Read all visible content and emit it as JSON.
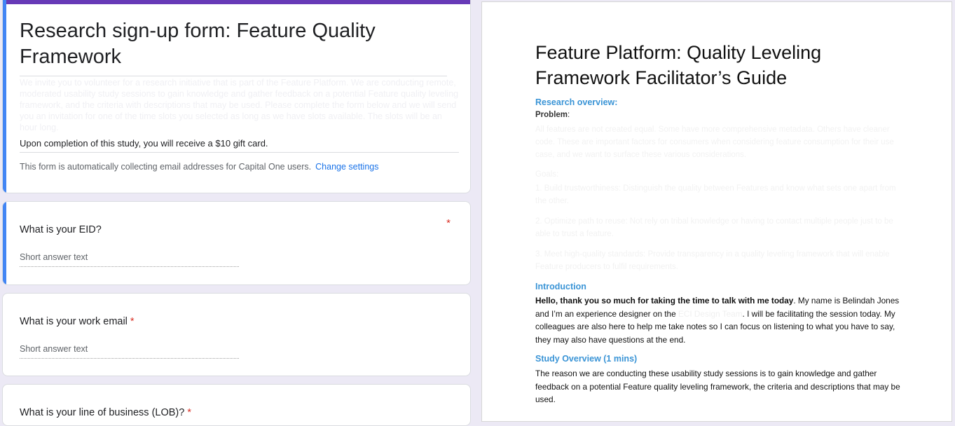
{
  "form": {
    "title": "Research sign-up form: Feature Quality Framework",
    "description": "We invite you to volunteer for a research initiative that is part of the Feature Platform. We are conducting remote, moderated usability study sessions to gain knowledge and gather feedback on a potential Feature quality leveling framework, and the criteria with descriptions that may be used. Please complete the form below and we will send you an invitation for one of the time slots you selected as long as we have slots available. The slots will be an hour long.",
    "note": "Upon completion of this study, you will receive a $10 gift card.",
    "collect_text": "This form is automatically collecting email addresses for Capital One users.",
    "collect_link": "Change settings",
    "questions": [
      {
        "title": "What is your EID?",
        "required_mark": "*",
        "placeholder": "Short answer text"
      },
      {
        "title": "What is your work email",
        "required_mark": "*",
        "placeholder": "Short answer text"
      },
      {
        "title": "What is your line of business (LOB)?",
        "required_mark": "*"
      }
    ],
    "colors": {
      "accent": "#673ab7",
      "focus_bar": "#4285f4",
      "required": "#d93025",
      "link": "#1a73e8"
    }
  },
  "doc": {
    "title": "Feature Platform: Quality Leveling Framework Facilitator’s Guide",
    "research_overview": "Research overview:",
    "problem_label": "Problem",
    "problem_colon": ":",
    "problem_text": "All features are not created equal. Some have more comprehensive metadata. Others have cleaner code. These are important factors for consumers when considering feature consumption for their use case, and we want to surface these various considerations.",
    "goals_label": "Goals:",
    "goals": [
      "1. Build trustworthiness: Distinguish the quality between Features and know what sets one apart from the other.",
      "2. Optimize path to reuse: Not rely on tribal knowledge or having to contact multiple people just to be able to trust a feature.",
      "3. Meet high-quality standards: Provide transparency in a quality leveling framework that will enable Feature producers to fulfil requirements."
    ],
    "intro_heading": "Introduction",
    "intro_bold": "Hello, thank you so much for taking the time to talk with me today",
    "intro_a": ". My name is Belindah Jones and I’m an experience designer on the ",
    "intro_ghost": "ECI Design Team",
    "intro_b": ". I will be facilitating the session today. My colleagues are also here to help me take notes so I can focus on listening to what you have to say, they may also have questions at the end.",
    "study_heading": "Study Overview (1 mins)",
    "study_text": "The reason we are conducting these usability study sessions is to gain knowledge and gather feedback on a potential Feature quality leveling framework, the criteria and descriptions that may be used.",
    "colors": {
      "heading": "#3a94d6"
    }
  }
}
